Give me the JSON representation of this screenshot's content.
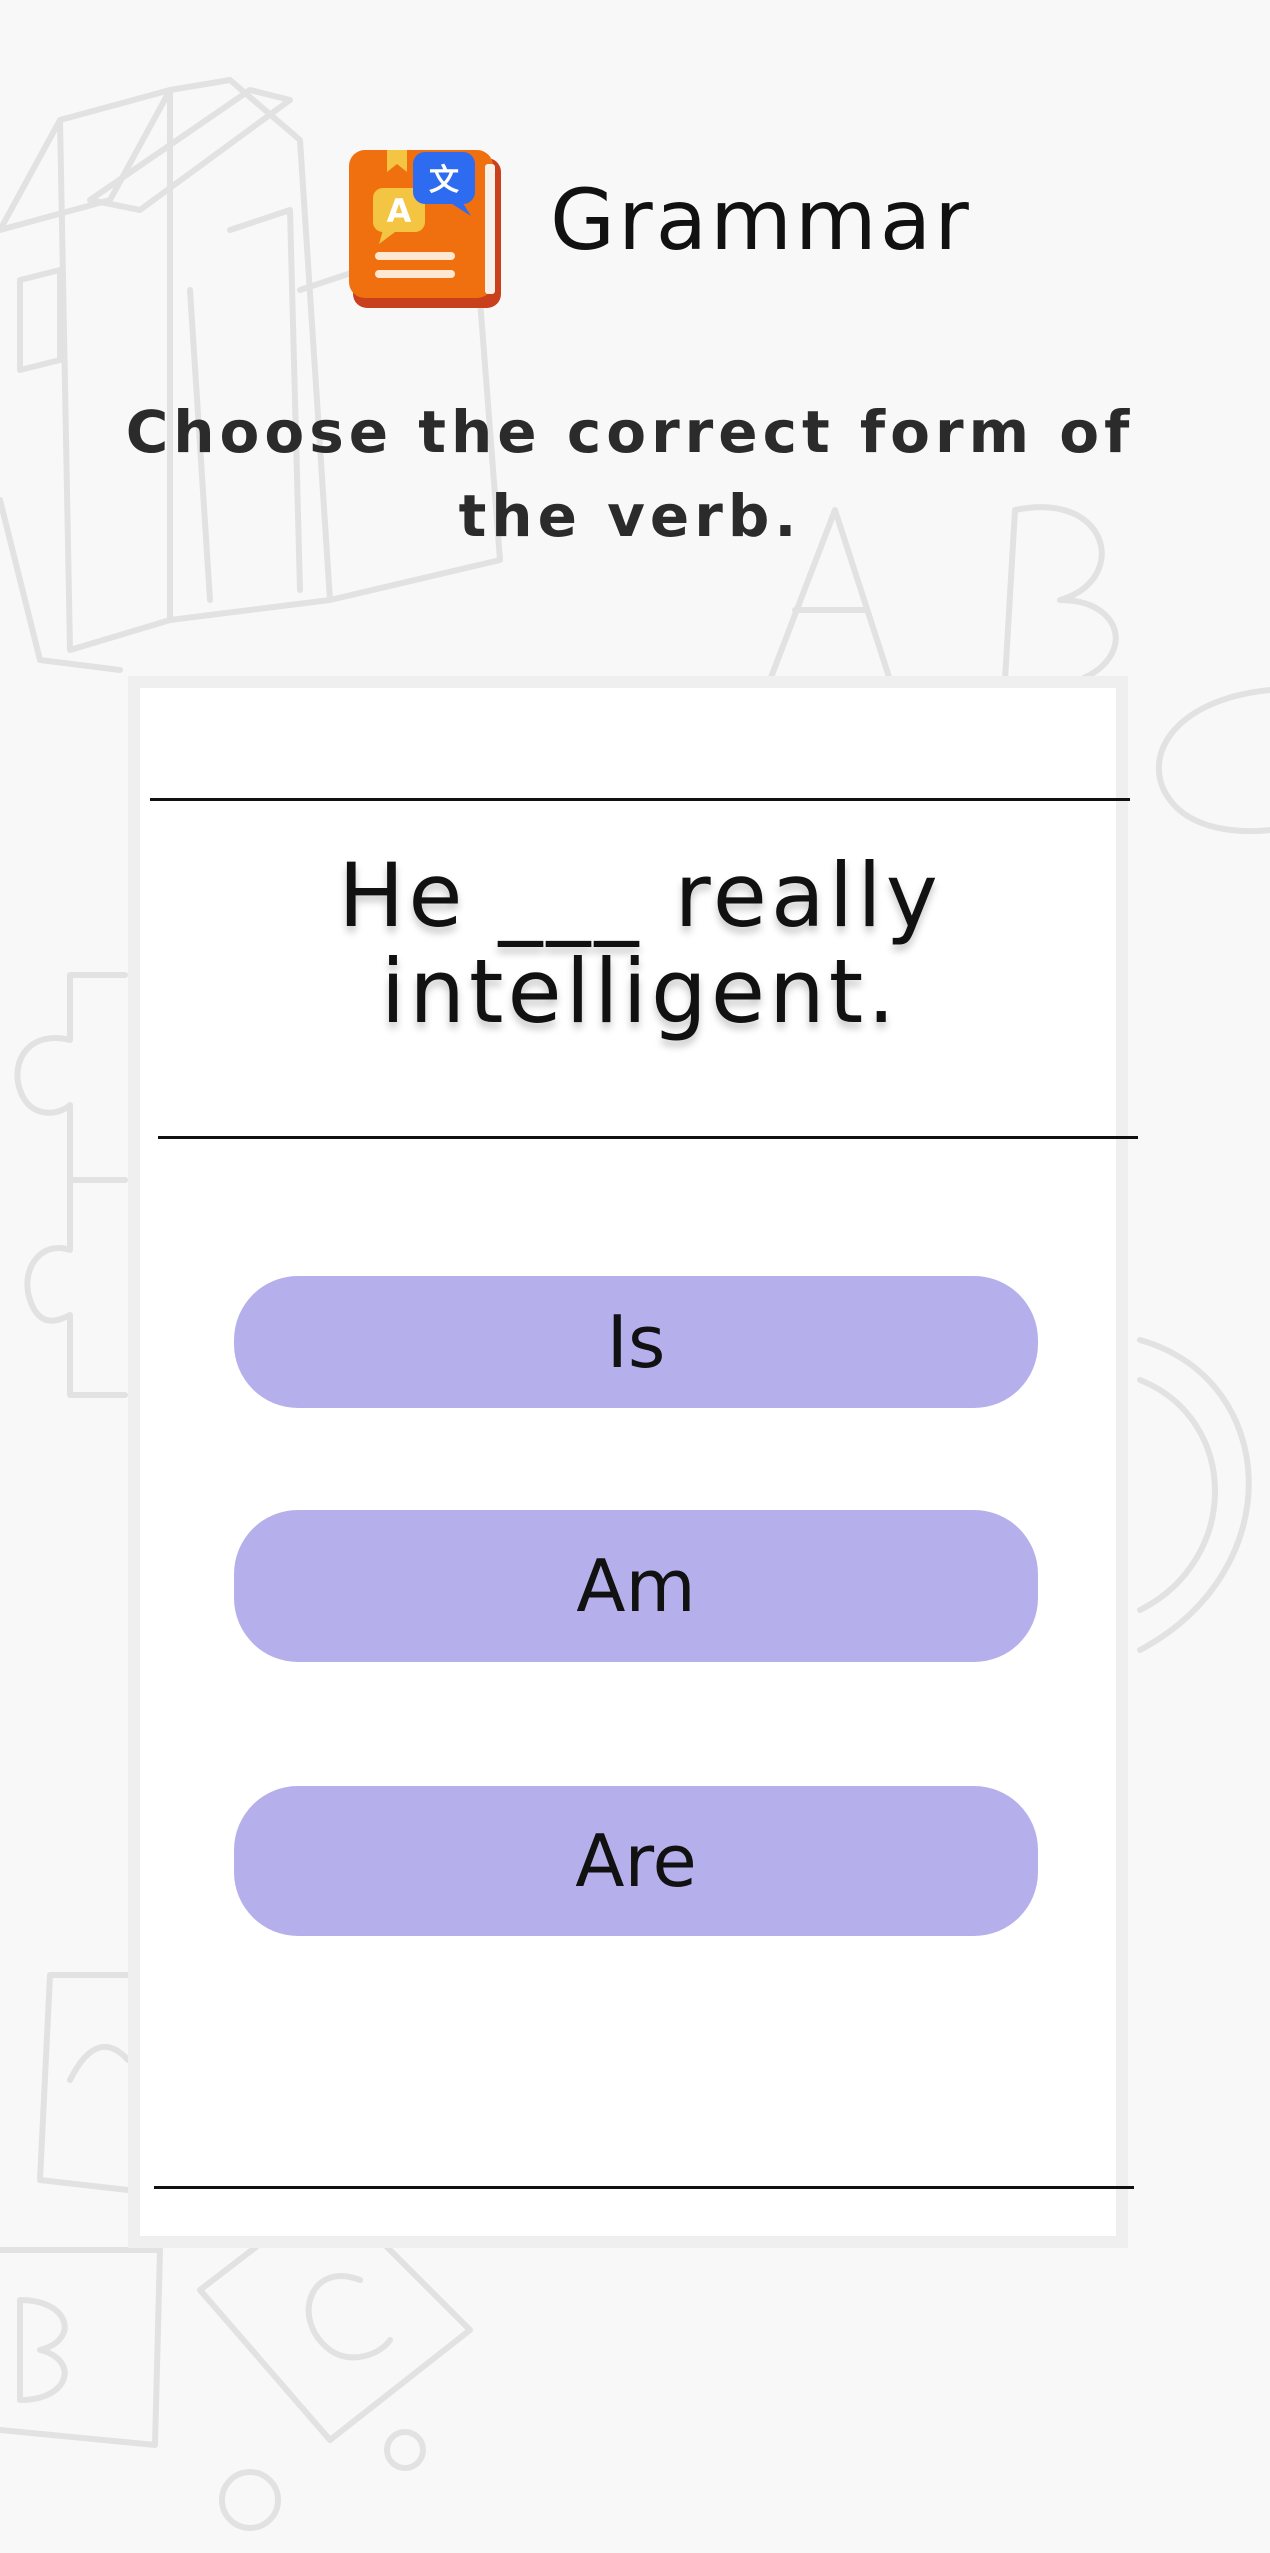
{
  "header": {
    "icon": "grammar-book-icon",
    "title": "Grammar"
  },
  "instruction": "Choose the correct form of the verb.",
  "question": "He ___ really intelligent.",
  "options": [
    {
      "label": "Is"
    },
    {
      "label": "Am"
    },
    {
      "label": "Are"
    }
  ],
  "colors": {
    "background": "#f8f8f8",
    "card": "#ffffff",
    "option": "#b5b0eb",
    "text": "#111111",
    "icon_book": "#f0700f",
    "icon_bubble_blue": "#2d6bf0",
    "icon_bubble_yellow": "#f4c542"
  }
}
